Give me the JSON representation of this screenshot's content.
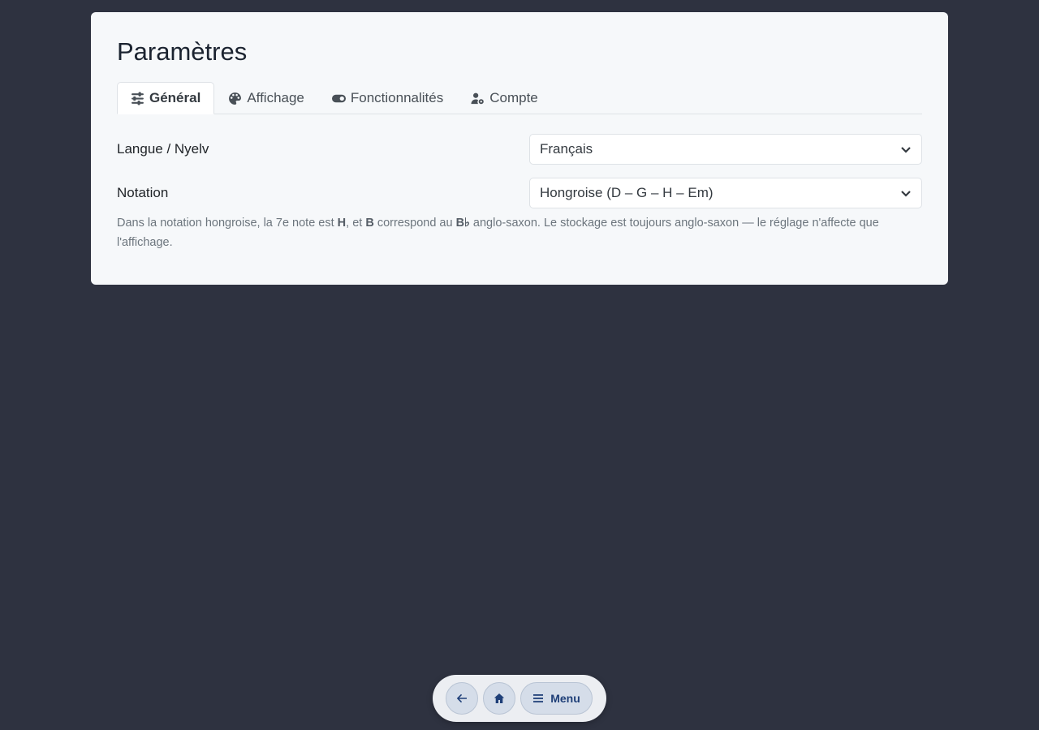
{
  "page": {
    "title": "Paramètres"
  },
  "tabs": [
    {
      "label": "Général",
      "icon": "sliders-icon",
      "active": true
    },
    {
      "label": "Affichage",
      "icon": "palette-icon",
      "active": false
    },
    {
      "label": "Fonctionnalités",
      "icon": "toggle-icon",
      "active": false
    },
    {
      "label": "Compte",
      "icon": "user-gear-icon",
      "active": false
    }
  ],
  "settings": {
    "language": {
      "label": "Langue / Nyelv",
      "value": "Français"
    },
    "notation": {
      "label": "Notation",
      "value": "Hongroise (D – G – H – Em)",
      "help_1": "Dans la notation hongroise, la 7e note est ",
      "help_h": "H",
      "help_2": ", et ",
      "help_b": "B",
      "help_3": " correspond au ",
      "help_bb": "B♭",
      "help_4": " anglo-saxon. Le stockage est toujours anglo-saxon — le réglage n'affecte que l'affichage."
    }
  },
  "dock": {
    "back_icon": "arrow-left-icon",
    "home_icon": "home-icon",
    "menu_label": "Menu",
    "menu_icon": "menu-icon"
  },
  "colors": {
    "background": "#2e3240",
    "card": "#f6f8fa",
    "dock_accent": "#1f3f78"
  }
}
